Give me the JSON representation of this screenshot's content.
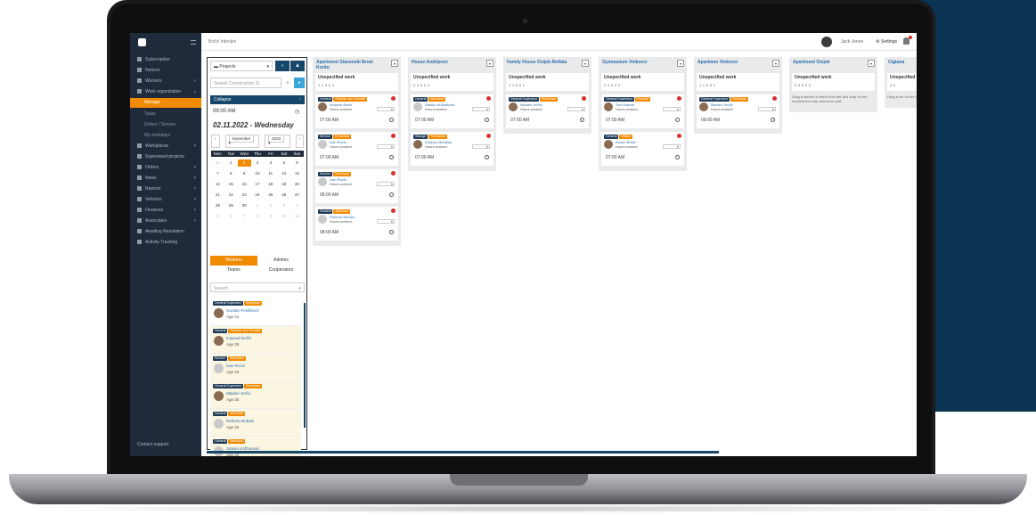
{
  "sidebar": {
    "items": [
      {
        "label": "Subscription",
        "arrow": ""
      },
      {
        "label": "Notices",
        "arrow": ""
      },
      {
        "label": "Workers",
        "arrow": "▾"
      },
      {
        "label": "Work organization",
        "arrow": "▴"
      },
      {
        "label": "Manage",
        "arrow": ""
      },
      {
        "label": "Tasks",
        "arrow": ""
      },
      {
        "label": "Defect / Service",
        "arrow": ""
      },
      {
        "label": "My workdays",
        "arrow": ""
      },
      {
        "label": "Workplaces",
        "arrow": "▾"
      },
      {
        "label": "Supervised projects",
        "arrow": ""
      },
      {
        "label": "Orders",
        "arrow": "▾"
      },
      {
        "label": "News",
        "arrow": "▾"
      },
      {
        "label": "Reports",
        "arrow": "▾"
      },
      {
        "label": "Vehicles",
        "arrow": "▾"
      },
      {
        "label": "Finances",
        "arrow": "▾"
      },
      {
        "label": "Associates",
        "arrow": "▾"
      },
      {
        "label": "Awaiting Resolution",
        "arrow": ""
      },
      {
        "label": "Activity Tracking",
        "arrow": ""
      }
    ],
    "footer": "Contact support"
  },
  "topbar": {
    "breadcrumb": "Božić Interijeri",
    "user": "Jack Jones",
    "settings": "Settings"
  },
  "left_panel": {
    "projects_select": "Projects",
    "search_placeholder": "Search Construction Si",
    "collapse": "Collapse",
    "time": "09:00 AM",
    "date": "02.11.2022 - Wednesday",
    "month": "November",
    "year": "2022",
    "dow": [
      "Mon",
      "Tue",
      "Wed",
      "Thu",
      "Fri",
      "Sat",
      "Sun"
    ],
    "days": [
      "31",
      "1",
      "2",
      "3",
      "4",
      "5",
      "6",
      "7",
      "8",
      "9",
      "10",
      "11",
      "12",
      "13",
      "14",
      "15",
      "16",
      "17",
      "18",
      "19",
      "20",
      "21",
      "22",
      "23",
      "24",
      "25",
      "26",
      "27",
      "28",
      "29",
      "30",
      "1",
      "2",
      "3",
      "4",
      "5",
      "6",
      "7",
      "8",
      "9",
      "10",
      "11"
    ],
    "tabs": [
      "Workers",
      "Admins",
      "Teams",
      "Cooperators"
    ],
    "list_search": "Search",
    "workers": [
      {
        "tags": [
          "General Supervisor",
          "Electrician"
        ],
        "name": "Gordan Perišković",
        "age": "Age 41"
      },
      {
        "tags": [
          "General",
          "Plumber and Tinsmith"
        ],
        "name": "Imanuel Božić",
        "age": "Age 28"
      },
      {
        "tags": [
          "Service",
          "Technician"
        ],
        "name": "Ivan Rozić",
        "age": "Age 43"
      },
      {
        "tags": [
          "General Supervisor",
          "Electrician"
        ],
        "name": "Mladen Jerčić",
        "age": "Age 35"
      },
      {
        "tags": [
          "General",
          "Mechanic"
        ],
        "name": "Roberto Bubalo",
        "age": "Age 32"
      },
      {
        "tags": [
          "General",
          "Mechanic"
        ],
        "name": "Stanko Krdžanović",
        "age": "Age 22"
      }
    ]
  },
  "columns": [
    {
      "title": "Apartment Slavonski Brod-Korito",
      "stats": "1  2  0  0  3",
      "cards": [
        {
          "tags": [
            "General",
            "Plumber and Tinsmith"
          ],
          "name": "Imanuel Božić",
          "hours_label": "Hours worked",
          "h": "h",
          "time": "07:00 AM"
        },
        {
          "tags": [
            "Service",
            "Technician"
          ],
          "name": "Ivan Rozić",
          "hours_label": "Hours worked",
          "h": "h",
          "time": "07:00 AM"
        },
        {
          "tags": [
            "Service",
            "Technician"
          ],
          "name": "Ivan Rozić",
          "hours_label": "Hours worked",
          "h": "h",
          "time": "08:00 AM"
        },
        {
          "tags": [
            "General",
            "Mechanic"
          ],
          "name": "Roberto Bubalo",
          "hours_label": "Hours worked",
          "h": "h",
          "time": "08:00 AM"
        }
      ]
    },
    {
      "title": "House Andrijevci",
      "stats": "2  2  0  0  2",
      "cards": [
        {
          "tags": [
            "General",
            "Mechanic"
          ],
          "name": "Stanko Krdžanović",
          "hours_label": "Hours worked",
          "h": "h",
          "time": "07:00 AM"
        },
        {
          "tags": [
            "Storage",
            "Technician"
          ],
          "name": "Zdravko Bertelaz",
          "hours_label": "Hours worked",
          "h": "h",
          "time": "07:00 AM"
        }
      ]
    },
    {
      "title": "Family House Osijek-Retfala",
      "stats": "1  1  0  0  1",
      "cards": [
        {
          "tags": [
            "General Supervisor",
            "Electrician"
          ],
          "name": "Mladen Jerčić",
          "hours_label": "Hours worked",
          "h": "h",
          "time": "07:00 AM"
        }
      ]
    },
    {
      "title": "Gymnasium Vinkovci",
      "stats": "2  2  0  0  2",
      "cards": [
        {
          "tags": [
            "General Supervisor",
            "Plumber"
          ],
          "name": "Toni Kasran",
          "hours_label": "Hours worked",
          "h": "h",
          "time": "07:00 AM"
        },
        {
          "tags": [
            "General",
            "Welder"
          ],
          "name": "Dunko Božić",
          "hours_label": "Hours worked",
          "h": "h",
          "time": "07:00 AM"
        }
      ]
    },
    {
      "title": "Apartmen Vinkovci",
      "stats": "1  1  0  0  1",
      "cards": [
        {
          "tags": [
            "General Supervisor",
            "Electrician"
          ],
          "name": "Mladen Jerčić",
          "hours_label": "Hours worked",
          "h": "h",
          "time": "09:00 AM"
        }
      ]
    },
    {
      "title": "Apartment Osijek",
      "stats": "0  0  0  0  0",
      "hint": "Drag a worker or team from left and drop on the construction site column to add.",
      "cards": []
    },
    {
      "title": "Cigtana",
      "stats": "0  0",
      "hint": "Drag a wo on the con",
      "cards": []
    }
  ],
  "unspecified_label": "Unspecified work"
}
